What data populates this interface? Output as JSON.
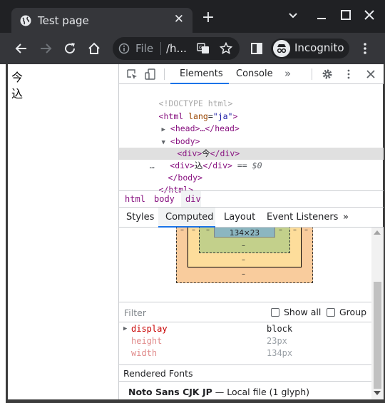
{
  "browser": {
    "tab_title": "Test page",
    "tab_close": "✕",
    "new_tab": "+",
    "scheme": "File",
    "url": "/h...",
    "profile_label": "Incognito"
  },
  "page": {
    "lines": [
      "今",
      "込"
    ]
  },
  "devtools": {
    "tabs": {
      "elements": "Elements",
      "console": "Console",
      "more": "»"
    },
    "dom": {
      "doctype": "<!DOCTYPE html>",
      "html_open_tag": "<html",
      "html_attr": "lang",
      "html_attr_val": "\"ja\"",
      "head": "<head>…</head>",
      "body_open": "<body>",
      "div1_open": "<div>",
      "div1_text": "今",
      "div1_close": "</div>",
      "div2_open": "<div>",
      "div2_text": "込",
      "div2_close": "</div>",
      "eq_marker": "== $0",
      "dots": "…",
      "body_close": "</body>",
      "html_close": "</html>"
    },
    "breadcrumbs": [
      "html",
      "body",
      "div"
    ],
    "subtabs": {
      "styles": "Styles",
      "computed": "Computed",
      "layout": "Layout",
      "listeners": "Event Listeners",
      "more": "»"
    },
    "box_model": {
      "content_size": "134×23",
      "dash": "–"
    },
    "filter": {
      "placeholder": "Filter",
      "show_all": "Show all",
      "group": "Group"
    },
    "properties": [
      {
        "name": "display",
        "value": "block"
      },
      {
        "name": "height",
        "value": "23px"
      },
      {
        "name": "width",
        "value": "134px"
      }
    ],
    "rendered_fonts": {
      "heading": "Rendered Fonts",
      "font_name": "Noto Sans CJK JP",
      "separator": "—",
      "source": "Local file",
      "glyphs": "(1 glyph)"
    }
  }
}
